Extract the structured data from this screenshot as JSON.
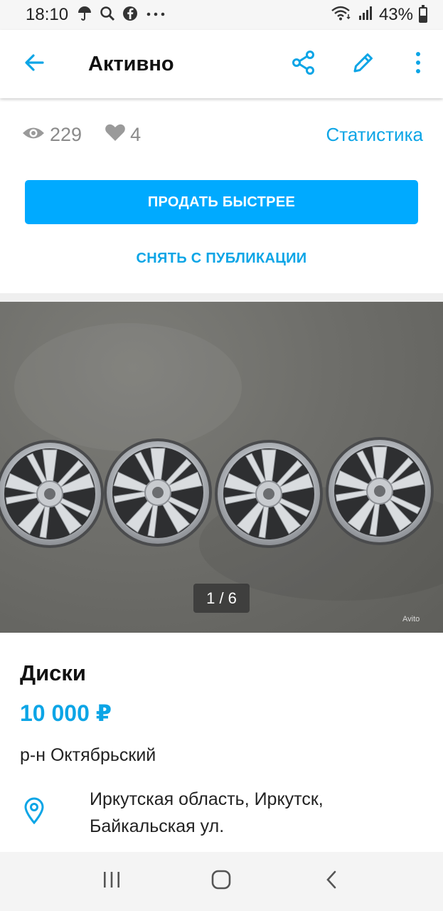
{
  "status_bar": {
    "time": "18:10",
    "battery_percent": "43%",
    "battery_level": 0.43,
    "icons": [
      "umbrella-icon",
      "search-icon",
      "facebook-icon",
      "more-notifications-icon",
      "wifi-icon",
      "signal-icon",
      "battery-icon"
    ]
  },
  "app_bar": {
    "title": "Активно",
    "icons": [
      "back-arrow-icon",
      "share-icon",
      "edit-pencil-icon",
      "more-vertical-icon"
    ]
  },
  "stats": {
    "views": "229",
    "favorites": "4",
    "link_label": "Статистика"
  },
  "buttons": {
    "primary": "ПРОДАТЬ БЫСТРЕЕ",
    "secondary": "СНЯТЬ С ПУБЛИКАЦИИ"
  },
  "photo": {
    "counter": "1 / 6",
    "watermark": "Avito",
    "description_icon": "photo-wheels"
  },
  "listing": {
    "title": "Диски",
    "price": "10 000 ₽",
    "district": "р-н Октябрьский",
    "address_line1": "Иркутская область, Иркутск,",
    "address_line2": "Байкальская ул."
  },
  "colors": {
    "accent": "#00aaff",
    "link": "#0ca5e6",
    "muted": "#8a8a8a"
  }
}
